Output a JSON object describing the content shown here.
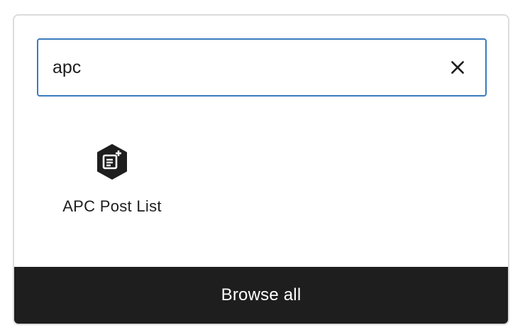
{
  "search": {
    "value": "apc",
    "clear_icon": "close-icon"
  },
  "results": [
    {
      "label": "APC Post List",
      "icon": "post-list-add-icon"
    }
  ],
  "footer": {
    "browse_all_label": "Browse all"
  },
  "colors": {
    "focus_border": "#3a7bbf",
    "footer_bg": "#1e1e1e",
    "text": "#1e1e1e",
    "panel_border": "#dcdcde"
  }
}
